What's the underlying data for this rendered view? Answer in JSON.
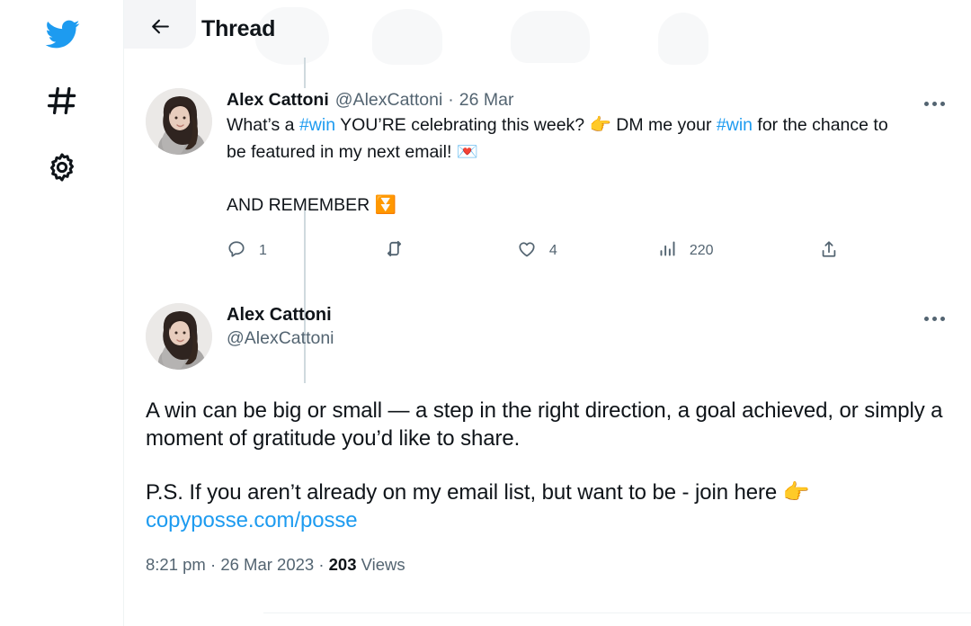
{
  "sidebar": {
    "items": [
      {
        "icon": "twitter-bird-icon",
        "name": "home-logo"
      },
      {
        "icon": "hashtag-icon",
        "name": "explore"
      },
      {
        "icon": "gear-icon",
        "name": "settings"
      }
    ]
  },
  "header": {
    "back_label": "Back",
    "title": "Thread"
  },
  "tweets": [
    {
      "display_name": "Alex Cattoni",
      "handle": "@AlexCattoni",
      "separator": "·",
      "date": "26 Mar",
      "text_parts": [
        {
          "type": "text",
          "value": "What’s a "
        },
        {
          "type": "hashtag",
          "value": "#win"
        },
        {
          "type": "text",
          "value": " YOU’RE celebrating this week? "
        },
        {
          "type": "emoji",
          "value": "👉"
        },
        {
          "type": "text",
          "value": " DM me your "
        },
        {
          "type": "hashtag",
          "value": "#win"
        },
        {
          "type": "text",
          "value": " for the chance to be featured in my next email! "
        },
        {
          "type": "emoji",
          "value": "💌"
        }
      ],
      "second_paragraph": "AND REMEMBER ",
      "second_paragraph_emoji": "⏬",
      "actions": {
        "reply_count": "1",
        "retweet_count": "",
        "like_count": "4",
        "views_count": "220",
        "share_label": ""
      }
    },
    {
      "display_name": "Alex Cattoni",
      "handle": "@AlexCattoni",
      "body_paragraph_1": "A win can be big or small — a step in the right direction, a goal achieved, or simply a moment of gratitude you’d like to share.",
      "body_paragraph_2_prefix": "P.S. If you aren’t already on my email list, but want to be - join here ",
      "body_paragraph_2_emoji": "👉",
      "body_link": "copyposse.com/posse",
      "meta": {
        "time": "8:21 pm",
        "sep1": "·",
        "date": "26 Mar 2023",
        "sep2": "·",
        "views_number": "203",
        "views_label": "Views"
      }
    }
  ],
  "colors": {
    "accent_blue": "#1d9bf0",
    "text_primary": "#0f1419",
    "text_secondary": "#536471",
    "divider": "#eff3f4",
    "thread_line": "#cfd9de"
  }
}
